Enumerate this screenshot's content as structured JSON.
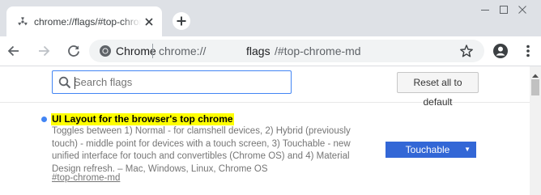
{
  "tab": {
    "title": "chrome://flags/#top-chrome-md"
  },
  "window_controls": {
    "minimize": "−",
    "maximize": "☐",
    "close": "✕"
  },
  "omnibox": {
    "chip_label": "Chrome",
    "url_prefix": "chrome://",
    "url_host": "flags",
    "url_path": "/#top-chrome-md"
  },
  "page": {
    "search_placeholder": "Search flags",
    "reset_label": "Reset all to default",
    "flag": {
      "title": "UI Layout for the browser's top chrome",
      "description": "Toggles between 1) Normal - for clamshell devices, 2) Hybrid (previously touch) - middle point for devices with a touch screen, 3) Touchable - new unified interface for touch and convertibles (Chrome OS) and 4) Material Design refresh. – Mac, Windows, Linux, Chrome OS",
      "link": "#top-chrome-md",
      "selected_option": "Touchable",
      "select_arrow": "▼"
    }
  },
  "colors": {
    "tabstrip": "#dee1e6",
    "accent": "#4285f4",
    "select_bg": "#3367d6",
    "highlight": "#ffff00"
  },
  "icons": [
    "flags-favicon-icon",
    "close-icon",
    "plus-icon",
    "back-arrow-icon",
    "forward-arrow-icon",
    "reload-icon",
    "chrome-logo-icon",
    "star-icon",
    "account-icon",
    "more-vert-icon",
    "search-icon"
  ]
}
